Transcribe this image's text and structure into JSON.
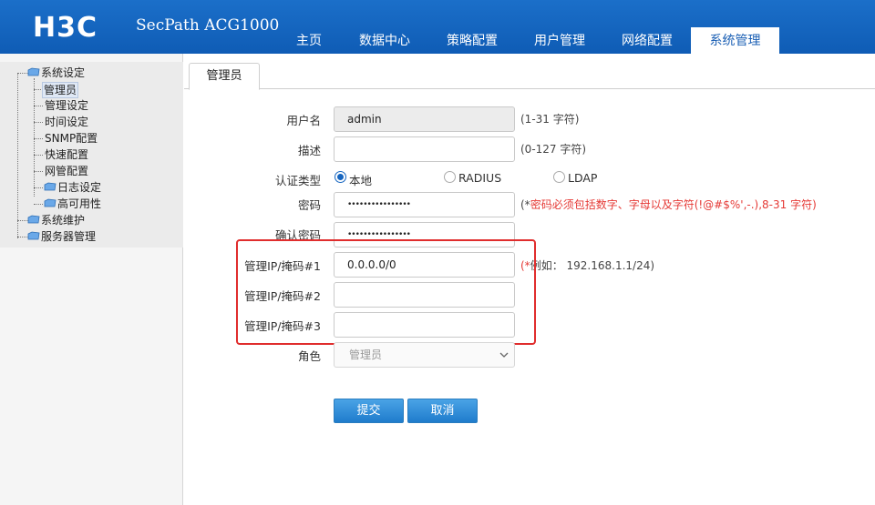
{
  "brand": {
    "logo_text": "H3C",
    "product": "SecPath ACG1000"
  },
  "nav": {
    "items": [
      {
        "label": "主页"
      },
      {
        "label": "数据中心"
      },
      {
        "label": "策略配置"
      },
      {
        "label": "用户管理"
      },
      {
        "label": "网络配置"
      },
      {
        "label": "系统管理"
      }
    ],
    "active": "系统管理"
  },
  "sidebar": {
    "system_settings": "系统设定",
    "children": [
      {
        "label": "管理员",
        "selected": true
      },
      {
        "label": "管理设定"
      },
      {
        "label": "时间设定"
      },
      {
        "label": "SNMP配置"
      },
      {
        "label": "快速配置"
      },
      {
        "label": "网管配置"
      },
      {
        "label": "日志设定"
      },
      {
        "label": "高可用性"
      }
    ],
    "maintenance": "系统维护",
    "server_mgmt": "服务器管理"
  },
  "tab": {
    "label": "管理员"
  },
  "form": {
    "username": {
      "label": "用户名",
      "value": "admin",
      "hint": "(1-31 字符)"
    },
    "description": {
      "label": "描述",
      "value": "",
      "hint": "(0-127 字符)"
    },
    "auth_type": {
      "label": "认证类型",
      "options": [
        "本地",
        "RADIUS",
        "LDAP"
      ],
      "selected": "本地"
    },
    "password": {
      "label": "密码",
      "value": "••••••••••••••••",
      "hint_star": "(*",
      "hint_text": "密码必须包括数字、字母以及字符(!@#$%',-.),8-31 字符)"
    },
    "confirm_password": {
      "label": "确认密码",
      "value": "••••••••••••••••"
    },
    "mgmt_ip1": {
      "label": "管理IP/掩码#1",
      "value": "0.0.0.0/0",
      "hint_star": "(*",
      "hint_text": "例如：  192.168.1.1/24)"
    },
    "mgmt_ip2": {
      "label": "管理IP/掩码#2",
      "value": ""
    },
    "mgmt_ip3": {
      "label": "管理IP/掩码#3",
      "value": ""
    },
    "role": {
      "label": "角色",
      "value": "管理员"
    }
  },
  "buttons": {
    "submit": "提交",
    "cancel": "取消"
  },
  "colors": {
    "header_blue": "#1565c0",
    "highlight_red": "#e02d2d",
    "button_blue": "#1f7ccc"
  }
}
